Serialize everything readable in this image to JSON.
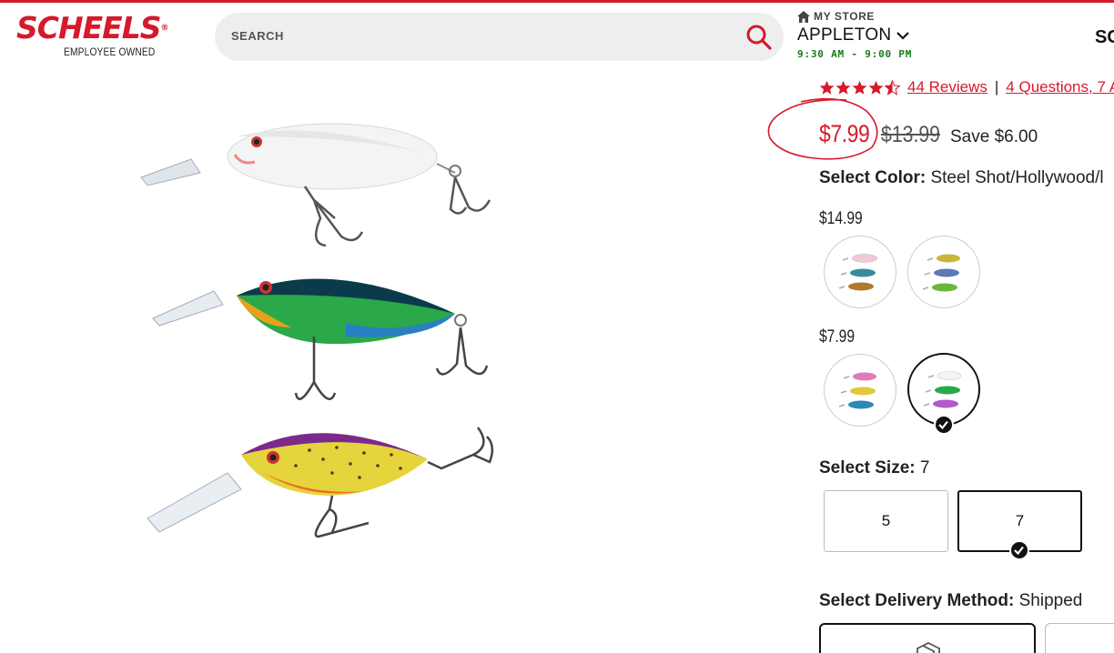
{
  "brand": {
    "name": "SCHEELS",
    "tagline": "EMPLOYEE OWNED"
  },
  "search": {
    "placeholder": "SEARCH"
  },
  "store": {
    "label": "MY STORE",
    "name": "APPLETON",
    "hours": "9:30 AM - 9:00 PM"
  },
  "header": {
    "clipped_link": "SC"
  },
  "rating": {
    "stars": 4.5,
    "reviews_link": "44 Reviews",
    "separator": "|",
    "questions_link": "4 Questions, 7 A"
  },
  "pricing": {
    "sale_price": "$7.99",
    "original_price": "$13.99",
    "savings": "Save $6.00"
  },
  "color": {
    "label": "Select Color:",
    "value": "Steel Shot/Hollywood/l"
  },
  "price_tiers": [
    {
      "price": "$14.99",
      "swatches": [
        "pink-yellow-green-lure-pack",
        "yellow-blue-green-lure-pack"
      ],
      "selected_index": -1
    },
    {
      "price": "$7.99",
      "swatches": [
        "pink-yellow-blue-lure-pack",
        "white-green-purple-lure-pack"
      ],
      "selected_index": 1
    }
  ],
  "size": {
    "label": "Select Size:",
    "value": "7",
    "options": [
      "5",
      "7"
    ],
    "selected": "7"
  },
  "delivery": {
    "label": "Select Delivery Method:",
    "value": "Shipped"
  },
  "colors": {
    "brand_red": "#d6192b",
    "hours_green": "#1a7a1a"
  }
}
